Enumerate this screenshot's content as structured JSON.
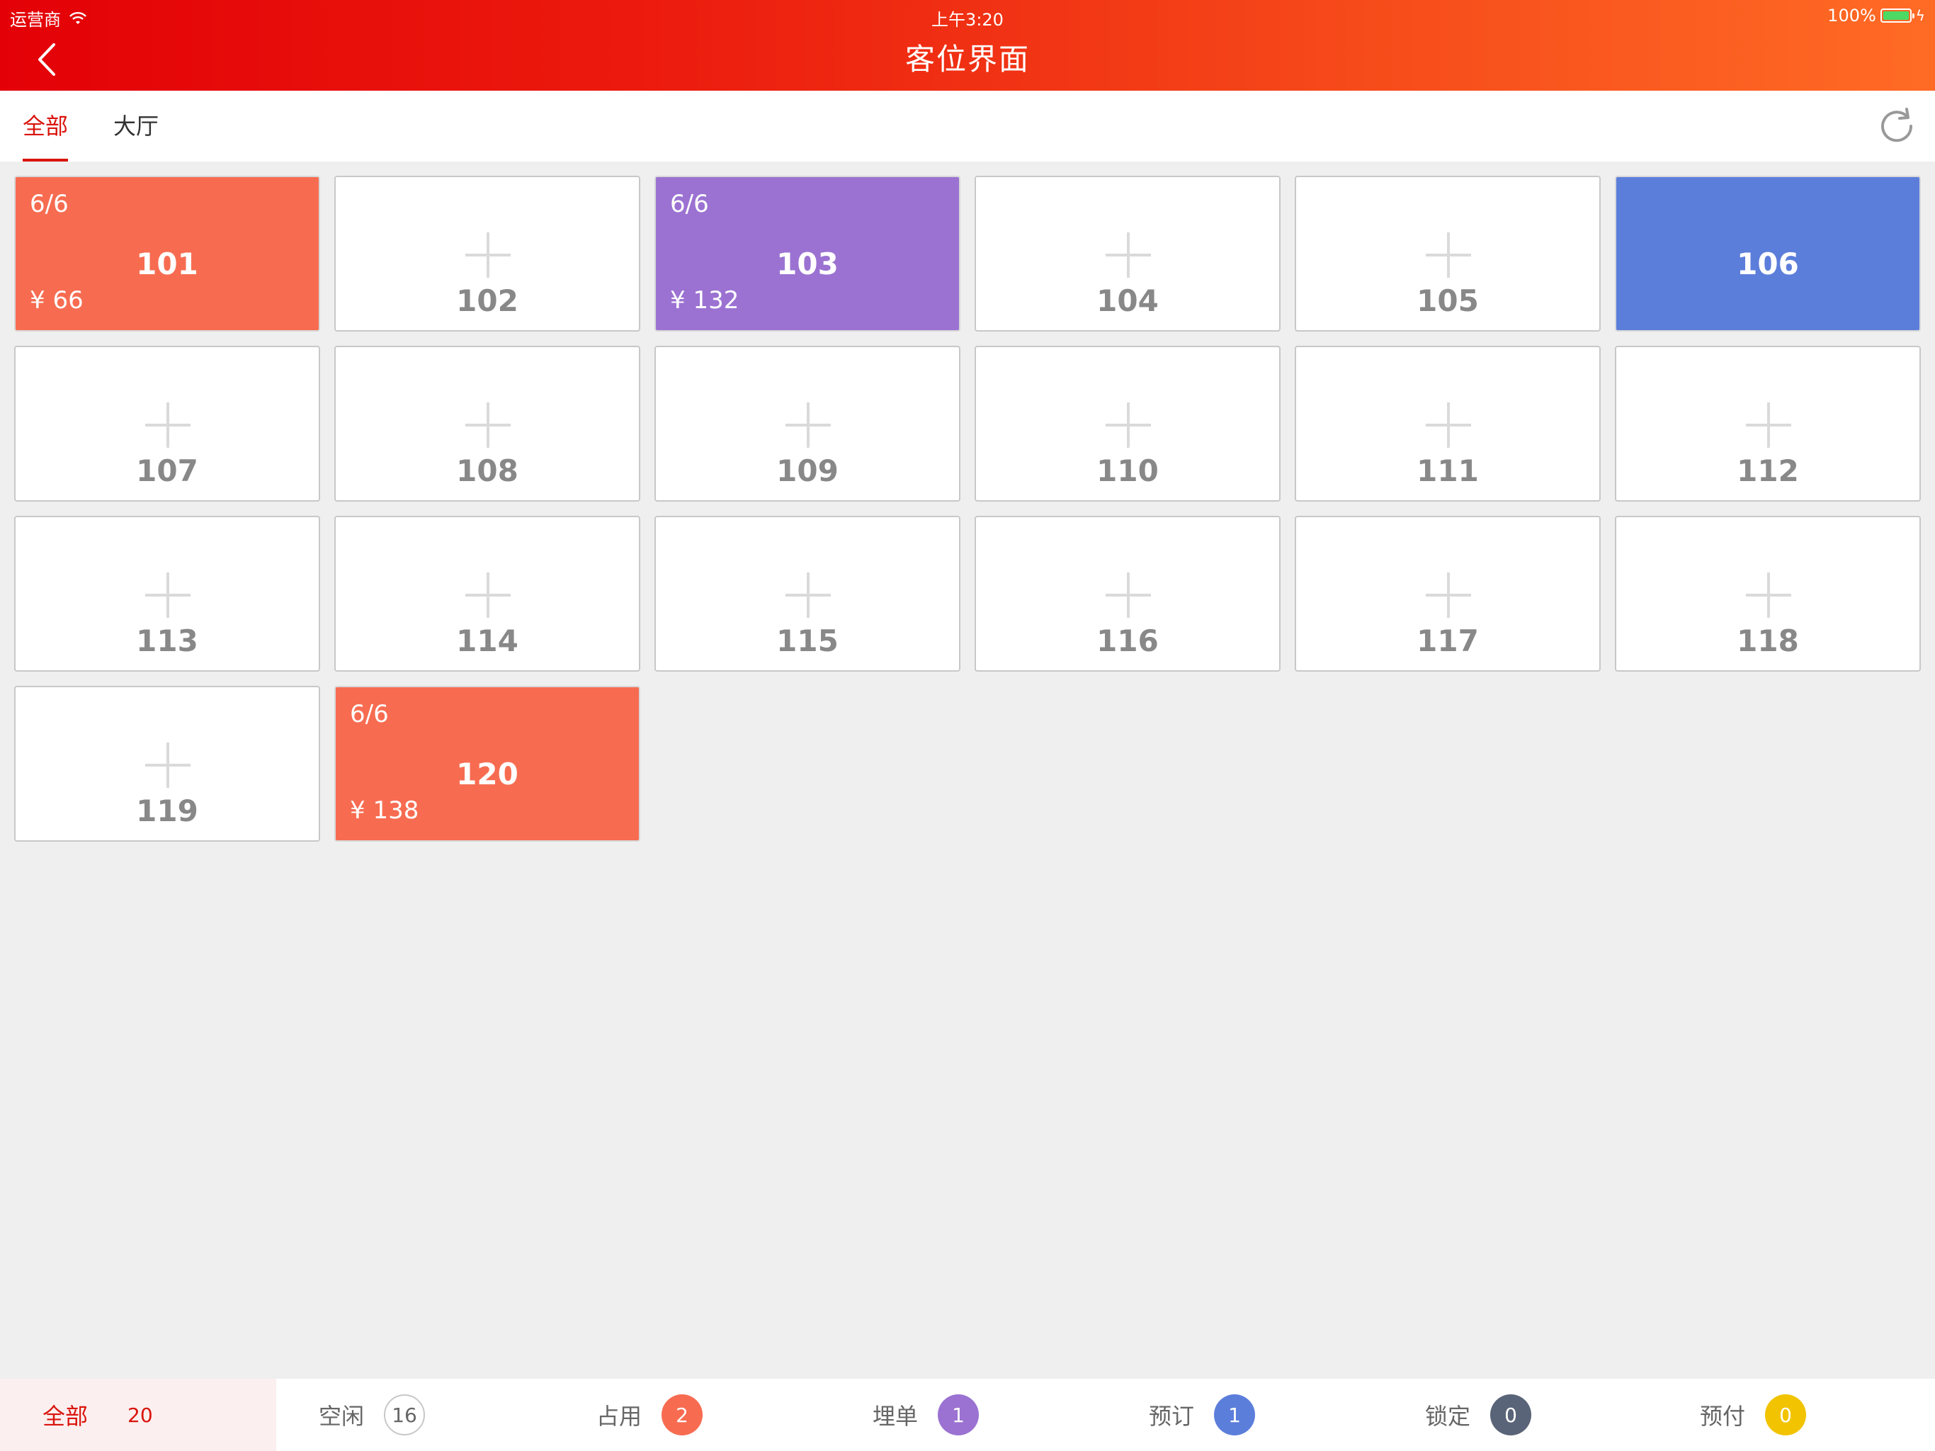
{
  "status_bar": {
    "carrier": "运营商",
    "time": "上午3:20",
    "battery": "100%"
  },
  "header": {
    "title": "客位界面"
  },
  "tabs": [
    {
      "label": "全部",
      "active": true
    },
    {
      "label": "大厅",
      "active": false
    }
  ],
  "tables": [
    {
      "number": "101",
      "state": "occupied",
      "guests": "6/6",
      "price": "¥ 66"
    },
    {
      "number": "102",
      "state": "free"
    },
    {
      "number": "103",
      "state": "bill",
      "guests": "6/6",
      "price": "¥ 132"
    },
    {
      "number": "104",
      "state": "free"
    },
    {
      "number": "105",
      "state": "free"
    },
    {
      "number": "106",
      "state": "reserved"
    },
    {
      "number": "107",
      "state": "free"
    },
    {
      "number": "108",
      "state": "free"
    },
    {
      "number": "109",
      "state": "free"
    },
    {
      "number": "110",
      "state": "free"
    },
    {
      "number": "111",
      "state": "free"
    },
    {
      "number": "112",
      "state": "free"
    },
    {
      "number": "113",
      "state": "free"
    },
    {
      "number": "114",
      "state": "free"
    },
    {
      "number": "115",
      "state": "free"
    },
    {
      "number": "116",
      "state": "free"
    },
    {
      "number": "117",
      "state": "free"
    },
    {
      "number": "118",
      "state": "free"
    },
    {
      "number": "119",
      "state": "free"
    },
    {
      "number": "120",
      "state": "occupied",
      "guests": "6/6",
      "price": "¥ 138"
    }
  ],
  "summary": {
    "all": {
      "label": "全部",
      "count": "20"
    },
    "items": [
      {
        "key": "free",
        "label": "空闲",
        "count": "16",
        "color": "#ffffff"
      },
      {
        "key": "occupied",
        "label": "占用",
        "count": "2",
        "color": "#f76c51"
      },
      {
        "key": "bill",
        "label": "埋单",
        "count": "1",
        "color": "#9b72d2"
      },
      {
        "key": "reserved",
        "label": "预订",
        "count": "1",
        "color": "#5c7edb"
      },
      {
        "key": "locked",
        "label": "锁定",
        "count": "0",
        "color": "#5a6478"
      },
      {
        "key": "prepaid",
        "label": "预付",
        "count": "0",
        "color": "#f2c300"
      }
    ]
  },
  "colors": {
    "header_start": "#e30107",
    "header_end": "#ff6b25",
    "accent": "#d9140c"
  }
}
